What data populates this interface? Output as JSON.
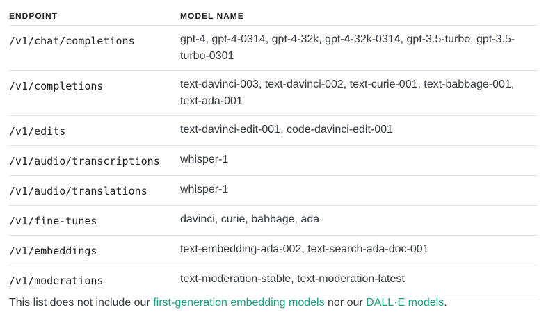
{
  "table": {
    "headers": [
      "ENDPOINT",
      "MODEL NAME"
    ],
    "rows": [
      {
        "endpoint": "/v1/chat/completions",
        "models": "gpt-4, gpt-4-0314, gpt-4-32k, gpt-4-32k-0314, gpt-3.5-turbo, gpt-3.5-turbo-0301"
      },
      {
        "endpoint": "/v1/completions",
        "models": "text-davinci-003, text-davinci-002, text-curie-001, text-babbage-001, text-ada-001"
      },
      {
        "endpoint": "/v1/edits",
        "models": "text-davinci-edit-001, code-davinci-edit-001"
      },
      {
        "endpoint": "/v1/audio/transcriptions",
        "models": "whisper-1"
      },
      {
        "endpoint": "/v1/audio/translations",
        "models": "whisper-1"
      },
      {
        "endpoint": "/v1/fine-tunes",
        "models": "davinci, curie, babbage, ada"
      },
      {
        "endpoint": "/v1/embeddings",
        "models": "text-embedding-ada-002, text-search-ada-doc-001"
      },
      {
        "endpoint": "/v1/moderations",
        "models": "text-moderation-stable, text-moderation-latest"
      }
    ]
  },
  "note": {
    "prefix": "This list does not include our ",
    "link1": "first-generation embedding models",
    "middle": " nor our ",
    "link2": "DALL·E models",
    "suffix": "."
  },
  "colors": {
    "link": "#10a37f",
    "text": "#353740",
    "border": "#e3e3e6"
  }
}
